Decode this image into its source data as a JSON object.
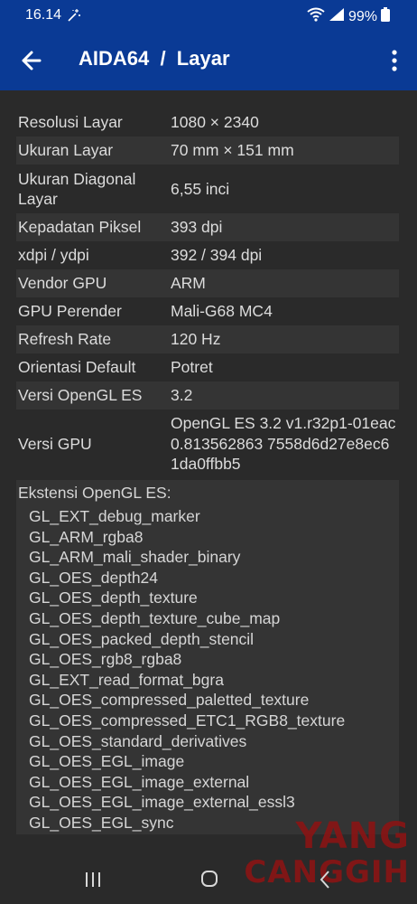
{
  "status_bar": {
    "time": "16.14",
    "battery": "99%"
  },
  "app_bar": {
    "title": "AIDA64  /  Layar"
  },
  "rows": [
    {
      "label": "Resolusi Layar",
      "value": "1080 × 2340"
    },
    {
      "label": "Ukuran Layar",
      "value": "70 mm × 151 mm"
    },
    {
      "label": "Ukuran Diagonal Layar",
      "value": "6,55 inci"
    },
    {
      "label": "Kepadatan Piksel",
      "value": "393 dpi"
    },
    {
      "label": "xdpi / ydpi",
      "value": "392 / 394 dpi"
    },
    {
      "label": "Vendor GPU",
      "value": "ARM"
    },
    {
      "label": "GPU Perender",
      "value": "Mali-G68 MC4"
    },
    {
      "label": "Refresh Rate",
      "value": "120 Hz"
    },
    {
      "label": "Orientasi Default",
      "value": "Potret"
    },
    {
      "label": "Versi OpenGL ES",
      "value": "3.2"
    },
    {
      "label": "Versi GPU",
      "value": "OpenGL ES 3.2 v1.r32p1-01eac0.813562863 7558d6d27e8ec61da0ffbb5"
    }
  ],
  "extensions": {
    "title": "Ekstensi OpenGL ES:",
    "items": [
      "GL_EXT_debug_marker",
      "GL_ARM_rgba8",
      "GL_ARM_mali_shader_binary",
      "GL_OES_depth24",
      "GL_OES_depth_texture",
      "GL_OES_depth_texture_cube_map",
      "GL_OES_packed_depth_stencil",
      "GL_OES_rgb8_rgba8",
      "GL_EXT_read_format_bgra",
      "GL_OES_compressed_paletted_texture",
      "GL_OES_compressed_ETC1_RGB8_texture",
      "GL_OES_standard_derivatives",
      "GL_OES_EGL_image",
      "GL_OES_EGL_image_external",
      "GL_OES_EGL_image_external_essl3",
      "GL_OES_EGL_sync"
    ]
  },
  "watermark": {
    "line1": "YANG",
    "line2": "CANGGIH"
  },
  "colors": {
    "app_bar": "#0a3a95",
    "background": "#2a2a2a",
    "alt_row": "#343434",
    "watermark": "#8a1414"
  }
}
